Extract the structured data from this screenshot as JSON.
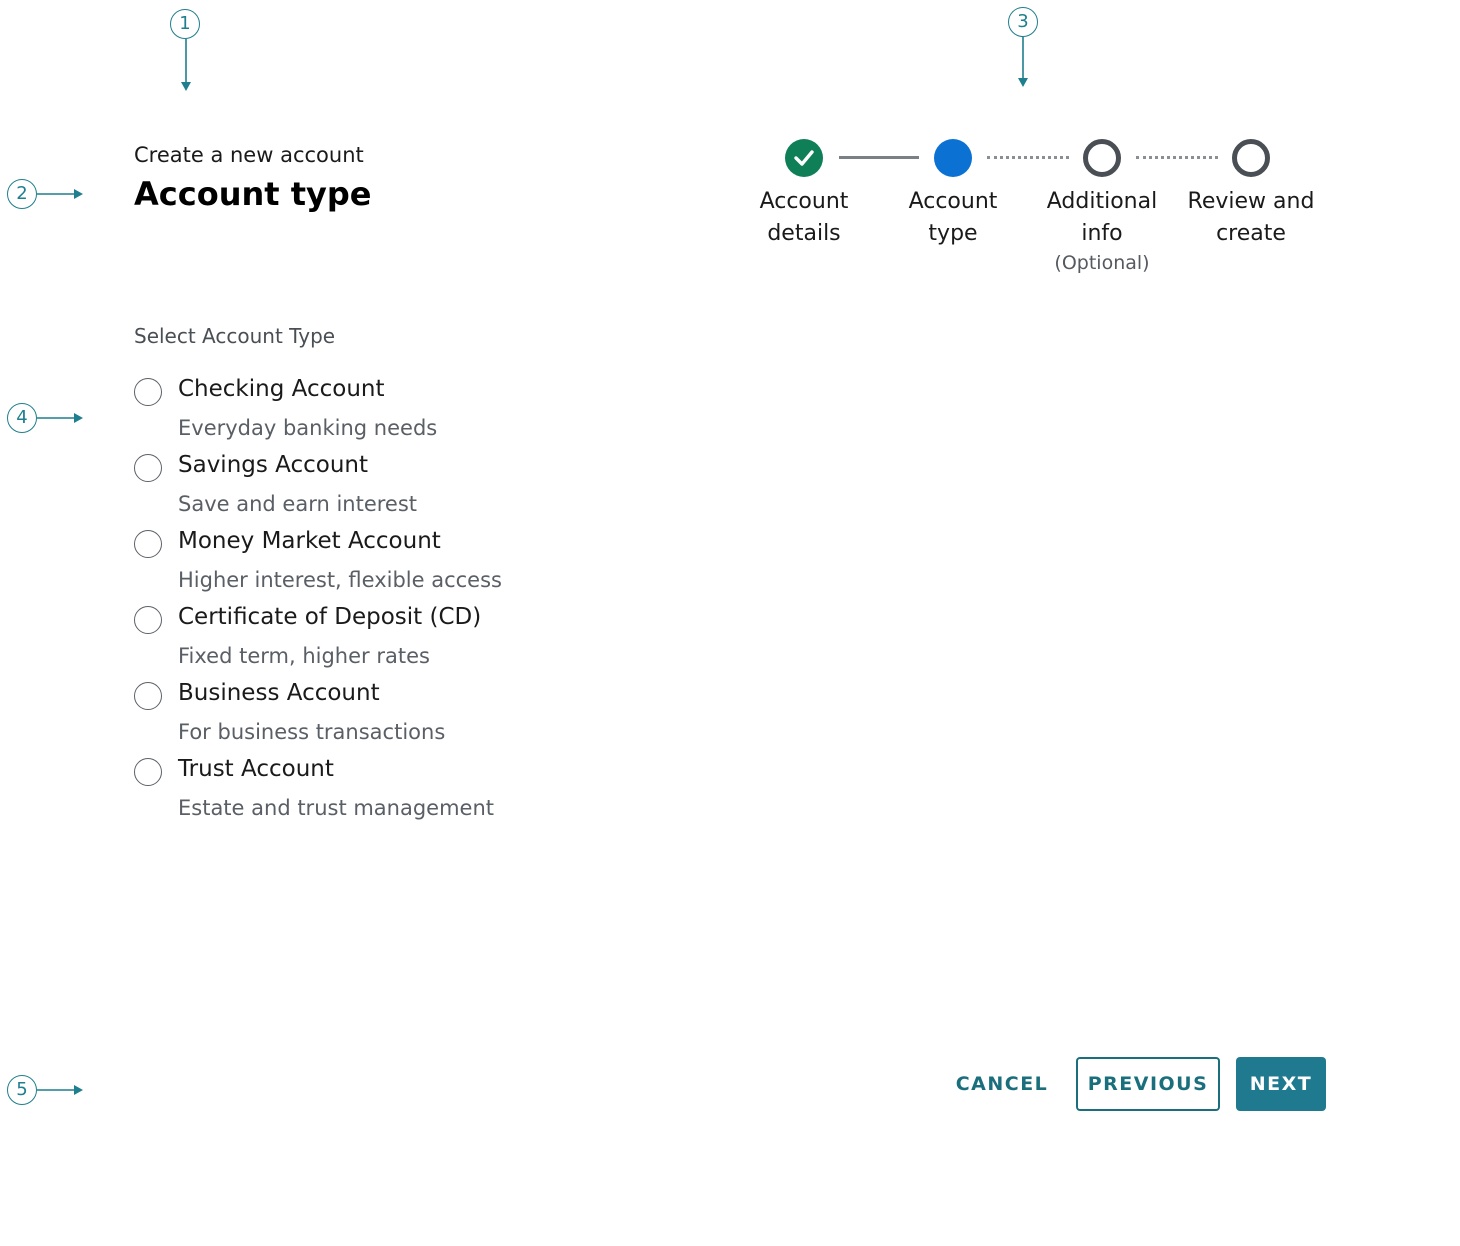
{
  "callouts": [
    "1",
    "2",
    "3",
    "4",
    "5"
  ],
  "header": {
    "eyebrow": "Create a new account",
    "title": "Account type"
  },
  "stepper": {
    "steps": [
      {
        "line1": "Account",
        "line2": "details",
        "sub": "",
        "state": "complete"
      },
      {
        "line1": "Account",
        "line2": "type",
        "sub": "",
        "state": "current"
      },
      {
        "line1": "Additional",
        "line2": "info",
        "sub": "(Optional)",
        "state": "incomplete"
      },
      {
        "line1": "Review and",
        "line2": "create",
        "sub": "",
        "state": "incomplete"
      }
    ]
  },
  "form": {
    "group_label": "Select Account Type",
    "options": [
      {
        "label": "Checking Account",
        "description": "Everyday banking needs",
        "selected": false
      },
      {
        "label": "Savings Account",
        "description": "Save and earn interest",
        "selected": false
      },
      {
        "label": "Money Market Account",
        "description": "Higher interest, flexible access",
        "selected": false
      },
      {
        "label": "Certificate of Deposit (CD)",
        "description": "Fixed term, higher rates",
        "selected": false
      },
      {
        "label": "Business Account",
        "description": "For business transactions",
        "selected": false
      },
      {
        "label": "Trust Account",
        "description": "Estate and trust management",
        "selected": false
      }
    ]
  },
  "footer": {
    "cancel_label": "CANCEL",
    "previous_label": "PREVIOUS",
    "next_label": "NEXT"
  },
  "colors": {
    "accent": "#1f7a90",
    "annotation": "#1f7f8e",
    "step_complete": "#0f7f58",
    "step_current": "#0b72d4",
    "step_incomplete": "#4a4f55"
  }
}
